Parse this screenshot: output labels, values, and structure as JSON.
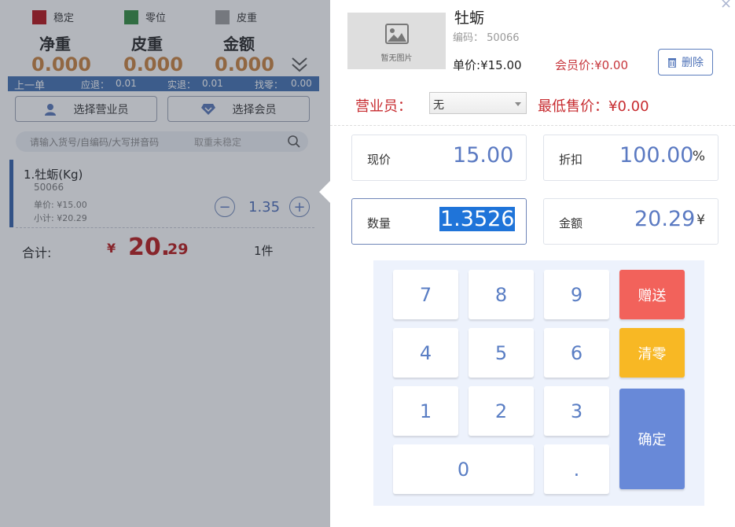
{
  "left_panel": {
    "legend": [
      {
        "label": "稳定",
        "color": "#b40d14"
      },
      {
        "label": "零位",
        "color": "#2e8a3a"
      },
      {
        "label": "皮重",
        "color": "#9b9b9b"
      }
    ],
    "labels": {
      "net": "净重",
      "tare": "皮重",
      "amount": "金额"
    },
    "values": {
      "net": "0.000",
      "tare": "0.000",
      "amount": "0.000"
    },
    "last_order": {
      "title": "上一单",
      "due_label": "应退：",
      "due": "0.01",
      "actual_label": "实退：",
      "actual": "0.01",
      "change_label": "找零：",
      "change": "0.00"
    },
    "select_clerk_button": "选择营业员",
    "select_member_button": "选择会员",
    "search": {
      "placeholder": "请输入货号/自编码/大写拼音码",
      "status": "取重未稳定"
    },
    "cart_item": {
      "name": "1.牡蛎(Kg)",
      "code": "50066",
      "unit_price": "单价: ¥15.00",
      "subtotal": "小计: ¥20.29",
      "qty": "1.35",
      "minus": "−",
      "plus": "+"
    },
    "total": {
      "label": "合计:",
      "currency": "¥",
      "integer": "20.",
      "decimal": "29",
      "count": "1件"
    }
  },
  "product": {
    "image_note": "暂无图片",
    "name": "牡蛎",
    "code_label": "编码：",
    "code": "50066",
    "price_label": "单价:",
    "price": "¥15.00",
    "member_label": "会员价:",
    "member_price": "¥0.00",
    "delete_button": "删除",
    "close": "×"
  },
  "clerk": {
    "label": "营业员：",
    "selected": "无",
    "min_price_label": "最低售价：",
    "min_price": "¥0.00"
  },
  "fields": {
    "price": {
      "label": "现价",
      "value": "15.00"
    },
    "discount": {
      "label": "折扣",
      "value": "100.00",
      "suffix": "%"
    },
    "quantity": {
      "label": "数量",
      "value": "1.3526"
    },
    "amount": {
      "label": "金额",
      "value": "20.29",
      "suffix": "¥"
    }
  },
  "keypad": {
    "k7": "7",
    "k8": "8",
    "k9": "9",
    "gift": "赠送",
    "k4": "4",
    "k5": "5",
    "k6": "6",
    "clear": "清零",
    "k1": "1",
    "k2": "2",
    "k3": "3",
    "confirm": "确定",
    "k0": "0",
    "dot": "."
  }
}
